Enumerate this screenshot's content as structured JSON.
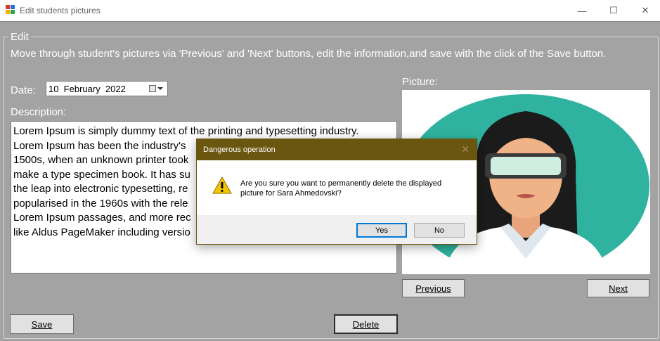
{
  "window": {
    "title": "Edit students pictures",
    "minimize_glyph": "—",
    "maximize_glyph": "☐",
    "close_glyph": "✕"
  },
  "group": {
    "legend": "Edit",
    "instructions": "Move through student's pictures via 'Previous' and 'Next' buttons,  edit the information,and save with the click of the Save button."
  },
  "form": {
    "date_label": "Date:",
    "date_value": "10  February  2022",
    "description_label": "Description:",
    "description_lines": [
      "Lorem Ipsum is simply dummy text of the printing and typesetting industry.",
      "Lorem Ipsum has been the industry's",
      "1500s, when an unknown printer took",
      "make a type specimen book. It has su",
      "the leap into electronic typesetting, re",
      "popularised in the 1960s with the rele",
      "Lorem Ipsum passages, and more rec",
      "like Aldus PageMaker including versio"
    ],
    "picture_label": "Picture:"
  },
  "buttons": {
    "previous": "Previous",
    "next": "Next",
    "save": "Save",
    "delete": "Delete"
  },
  "dialog": {
    "title": "Dangerous operation",
    "close_glyph": "✕",
    "message": "Are you sure you want to permanently delete the displayed picture for Sara Ahmedovski?",
    "icon": "warning-icon",
    "yes": "Yes",
    "no": "No"
  },
  "colors": {
    "dialog_title_bg": "#6b5610",
    "avatar_circle": "#2fb3a0",
    "warning_yellow": "#f5c400"
  }
}
